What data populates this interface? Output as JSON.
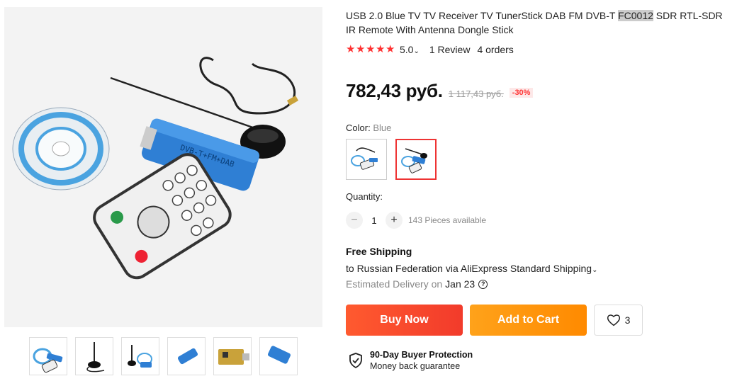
{
  "product": {
    "title_before": "USB 2.0 Blue TV TV Receiver TV TunerStick DAB FM DVB-T ",
    "title_highlight": "FC0012",
    "title_after": " SDR RTL-SDR IR Remote With Antenna Dongle Stick"
  },
  "rating": {
    "stars": 5,
    "score": "5.0",
    "reviews": "1 Review",
    "orders": "4 orders"
  },
  "price": {
    "current": "782,43 руб.",
    "original": "1 117,43 руб.",
    "discount": "-30%"
  },
  "color": {
    "label": "Color:",
    "value": "Blue",
    "selected_index": 1,
    "accent": "#e33333"
  },
  "quantity": {
    "label": "Quantity:",
    "value": "1",
    "minus": "−",
    "plus": "+",
    "available": "143 Pieces available"
  },
  "shipping": {
    "title": "Free Shipping",
    "destination": "to Russian Federation via AliExpress Standard Shipping",
    "estimated_label": "Estimated Delivery on",
    "estimated_date": "Jan 23",
    "help_icon": "?"
  },
  "actions": {
    "buy_now": "Buy Now",
    "add_to_cart": "Add to Cart",
    "wishlist_count": "3"
  },
  "protection": {
    "title": "90-Day Buyer Protection",
    "subtitle": "Money back guarantee"
  },
  "icons": {
    "star": "★",
    "chevron": "⌄"
  },
  "colors": {
    "buy": "#f23b2b",
    "cart": "#ff8a00",
    "star": "#ff3333"
  }
}
